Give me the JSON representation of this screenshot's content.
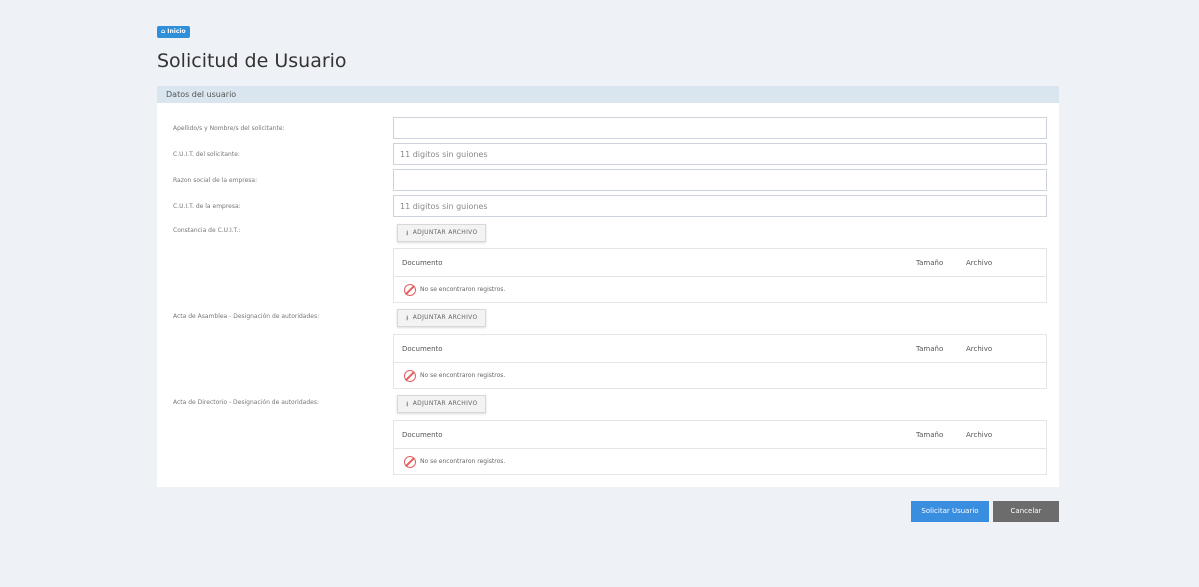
{
  "breadcrumb": {
    "icon": "home-icon",
    "label": "Inicio"
  },
  "page": {
    "title": "Solicitud de Usuario"
  },
  "card": {
    "header": "Datos del usuario"
  },
  "fields": [
    {
      "label": "Apellido/s y Nombre/s del solicitante:",
      "value": "",
      "placeholder": ""
    },
    {
      "label": "C.U.I.T. del solicitante:",
      "value": "",
      "placeholder": "11 digitos sin guiones"
    },
    {
      "label": "Razon social de la empresa:",
      "value": "",
      "placeholder": ""
    },
    {
      "label": "C.U.I.T. de la empresa:",
      "value": "",
      "placeholder": "11 digitos sin guiones"
    }
  ],
  "attachments": [
    {
      "label": "Constancia de C.U.I.T.:",
      "button": "ADJUNTAR ARCHIVO",
      "columns": [
        "Documento",
        "Tamaño",
        "Archivo"
      ],
      "empty": "No se encontraron registros."
    },
    {
      "label": "Acta de Asamblea - Designación de autoridades:",
      "button": "ADJUNTAR ARCHIVO",
      "columns": [
        "Documento",
        "Tamaño",
        "Archivo"
      ],
      "empty": "No se encontraron registros."
    },
    {
      "label": "Acta de Directorio - Designación de autoridades:",
      "button": "ADJUNTAR ARCHIVO",
      "columns": [
        "Documento",
        "Tamaño",
        "Archivo"
      ],
      "empty": "No se encontraron registros."
    }
  ],
  "actions": {
    "submit": "Solicitar Usuario",
    "cancel": "Cancelar"
  },
  "colors": {
    "primary": "#3a8ee0",
    "secondary": "#6c6c6c",
    "header_bg": "#d9e6ef",
    "background": "#eef2f6"
  }
}
